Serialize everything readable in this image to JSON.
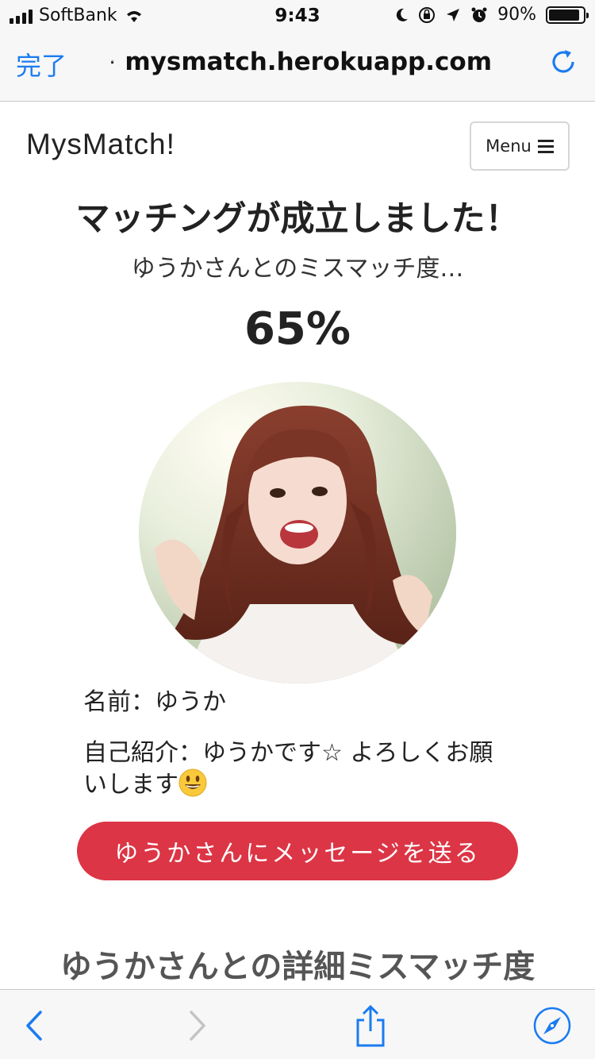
{
  "status_bar": {
    "carrier": "SoftBank",
    "time": "9:43",
    "battery": "90%",
    "battery_level": 0.9,
    "icons": [
      "signal-icon",
      "wifi-icon",
      "moon-icon",
      "orientation-lock-icon",
      "location-icon",
      "alarm-icon",
      "battery-icon"
    ]
  },
  "browser": {
    "done_label": "完了",
    "url": "mysmatch.herokuapp.com",
    "icons": [
      "lock-icon",
      "reload-icon"
    ],
    "toolbar_icons": [
      "back-icon",
      "forward-icon",
      "share-icon",
      "compass-icon"
    ]
  },
  "navbar": {
    "brand": "MysMatch!",
    "menu_label": "Menu",
    "menu_icon": "hamburger-icon"
  },
  "match": {
    "headline": "マッチングが成立しました！",
    "subline": "ゆうかさんとのミスマッチ度…",
    "percent": "65%"
  },
  "profile": {
    "avatar_icon": "profile-photo",
    "name_line": "名前：ゆうか",
    "bio_line": "自己紹介：ゆうかです☆ よろしくお願いします",
    "bio_emoji": "smiley-emoji-icon"
  },
  "actions": {
    "message_button": "ゆうかさんにメッセージを送る"
  },
  "detail": {
    "heading": "ゆうかさんとの詳細ミスマッチ度"
  },
  "colors": {
    "accent_blue": "#1a7cf0",
    "button_red": "#dc3545",
    "text_dark": "#222222",
    "heading_gray": "#555555"
  }
}
